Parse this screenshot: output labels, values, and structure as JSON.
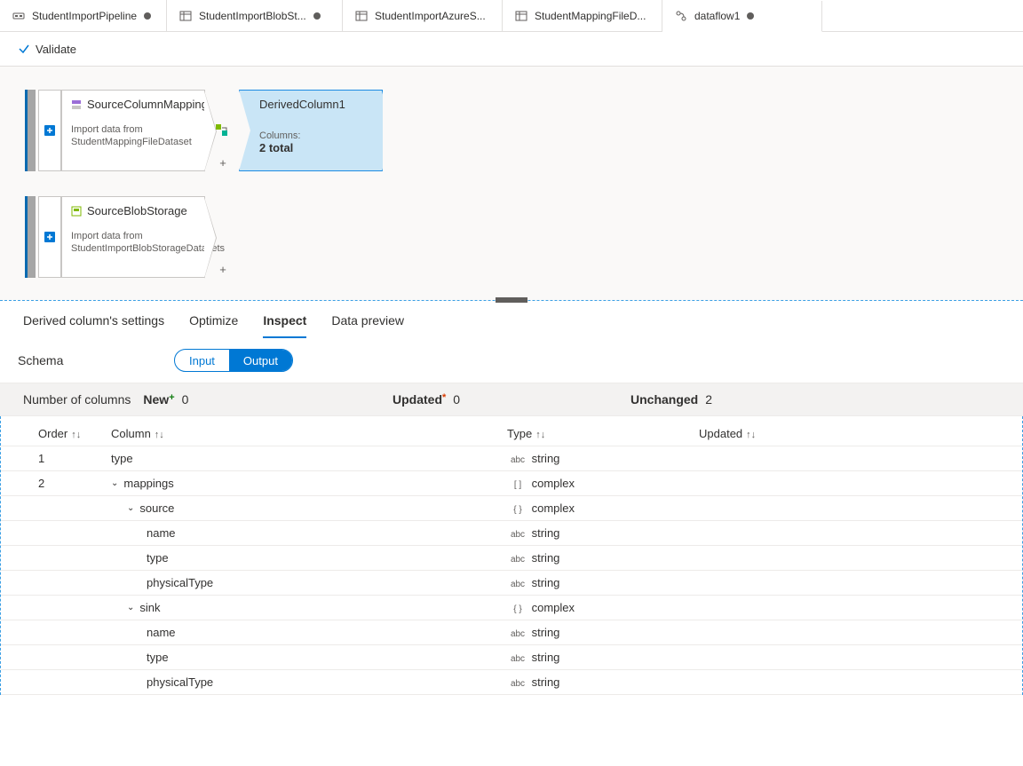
{
  "tabs": {
    "items": [
      {
        "label": "StudentImportPipeline",
        "dirty": true,
        "icon": "pipeline"
      },
      {
        "label": "StudentImportBlobSt...",
        "dirty": true,
        "icon": "dataset"
      },
      {
        "label": "StudentImportAzureS...",
        "dirty": false,
        "icon": "dataset"
      },
      {
        "label": "StudentMappingFileD...",
        "dirty": false,
        "icon": "dataset"
      },
      {
        "label": "dataflow1",
        "dirty": true,
        "icon": "dataflow"
      }
    ]
  },
  "toolbar": {
    "validate": "Validate"
  },
  "nodes": {
    "source1": {
      "title": "SourceColumnMapping",
      "desc": "Import data from StudentMappingFileDataset"
    },
    "derived": {
      "title": "DerivedColumn1",
      "columns_label": "Columns:",
      "columns_value": "2 total"
    },
    "source2": {
      "title": "SourceBlobStorage",
      "desc": "Import data from StudentImportBlobStorageDatasets"
    }
  },
  "settings": {
    "tabs": {
      "derived": "Derived column's settings",
      "optimize": "Optimize",
      "inspect": "Inspect",
      "preview": "Data preview"
    },
    "schema_label": "Schema",
    "toggle": {
      "input": "Input",
      "output": "Output"
    }
  },
  "counts": {
    "numcols_label": "Number of columns",
    "new_label": "New",
    "new_val": "0",
    "updated_label": "Updated",
    "updated_val": "0",
    "unchanged_label": "Unchanged",
    "unchanged_val": "2"
  },
  "table": {
    "h_order": "Order",
    "h_column": "Column",
    "h_type": "Type",
    "h_updated": "Updated",
    "rows": [
      {
        "order": "1",
        "col": "type",
        "indent": 0,
        "typeBadge": "abc",
        "type": "string"
      },
      {
        "order": "2",
        "col": "mappings",
        "indent": 1,
        "typeBadge": "[ ]",
        "type": "complex"
      },
      {
        "order": "",
        "col": "source",
        "indent": 2,
        "typeBadge": "{ }",
        "type": "complex"
      },
      {
        "order": "",
        "col": "name",
        "indent": 3,
        "typeBadge": "abc",
        "type": "string"
      },
      {
        "order": "",
        "col": "type",
        "indent": 3,
        "typeBadge": "abc",
        "type": "string"
      },
      {
        "order": "",
        "col": "physicalType",
        "indent": 3,
        "typeBadge": "abc",
        "type": "string"
      },
      {
        "order": "",
        "col": "sink",
        "indent": 2,
        "typeBadge": "{ }",
        "type": "complex"
      },
      {
        "order": "",
        "col": "name",
        "indent": 3,
        "typeBadge": "abc",
        "type": "string"
      },
      {
        "order": "",
        "col": "type",
        "indent": 3,
        "typeBadge": "abc",
        "type": "string"
      },
      {
        "order": "",
        "col": "physicalType",
        "indent": 3,
        "typeBadge": "abc",
        "type": "string"
      }
    ]
  }
}
